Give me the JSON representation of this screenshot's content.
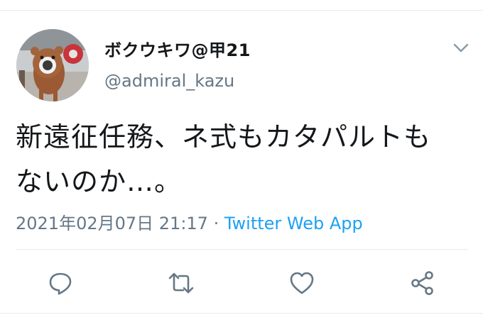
{
  "tweet": {
    "display_name": "ボクウキワ@甲21",
    "handle": "@admiral_kazu",
    "text_lines": [
      "新遠征任務、ネ式もカタパルトも",
      "ないのか…。"
    ],
    "timestamp": "2021年02月07日 21:17",
    "separator": " · ",
    "source": "Twitter Web App"
  },
  "colors": {
    "text_primary": "#14171a",
    "text_secondary": "#657786",
    "link": "#1da1f2",
    "divider": "#e6ecf0"
  },
  "icons": {
    "menu": "chevron-down-icon",
    "reply": "reply-icon",
    "retweet": "retweet-icon",
    "like": "heart-icon",
    "share": "share-icon"
  }
}
